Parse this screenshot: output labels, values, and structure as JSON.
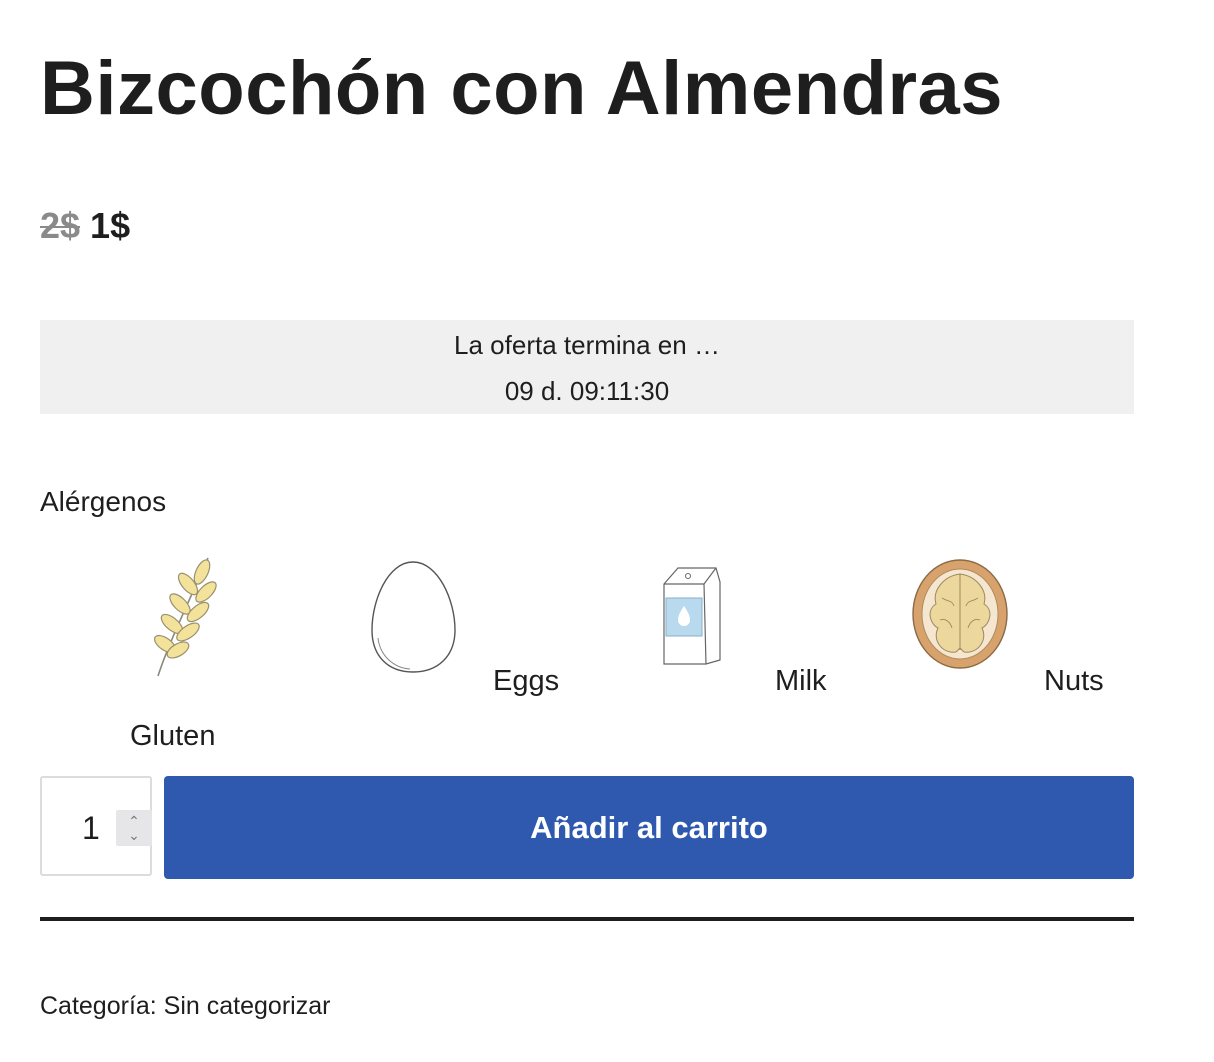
{
  "product": {
    "title": "Bizcochón con Almendras",
    "old_price": "2$",
    "new_price": "1$"
  },
  "offer": {
    "label": "La oferta termina en …",
    "countdown": "09 d. 09:11:30"
  },
  "allergens": {
    "title": "Alérgenos",
    "items": [
      {
        "label": "Gluten",
        "icon": "wheat-icon"
      },
      {
        "label": "Eggs",
        "icon": "egg-icon"
      },
      {
        "label": "Milk",
        "icon": "milk-carton-icon"
      },
      {
        "label": "Nuts",
        "icon": "walnut-icon"
      }
    ]
  },
  "cart": {
    "quantity": "1",
    "button_label": "Añadir al carrito"
  },
  "meta": {
    "category": "Categoría: Sin categorizar"
  },
  "colors": {
    "accent": "#2f59af",
    "offer_bg": "#f0f0f1"
  }
}
